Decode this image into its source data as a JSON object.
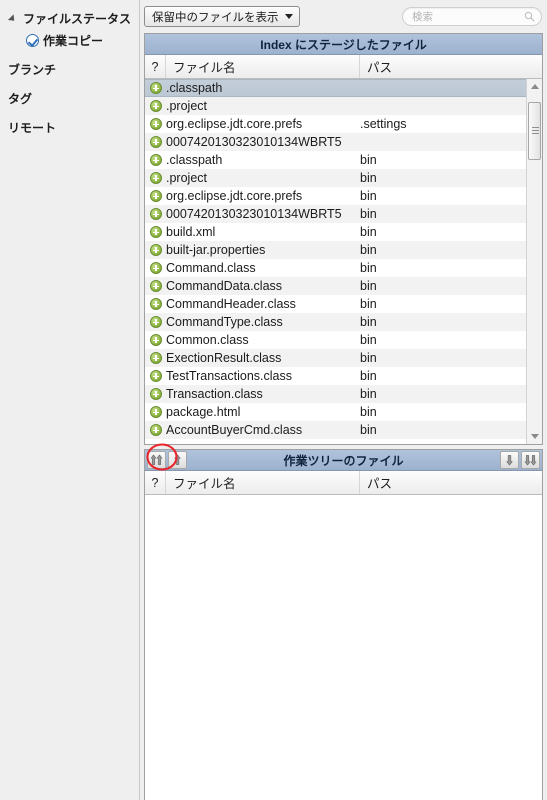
{
  "sidebar": {
    "items": [
      {
        "label": "ファイルステータス",
        "icon": "disclosure-triangle-icon",
        "level": 0,
        "selected": false
      },
      {
        "label": "作業コピー",
        "icon": "check-circle-icon",
        "level": 1,
        "selected": false
      },
      {
        "label": "ブランチ",
        "icon": "",
        "level": 0,
        "selected": false
      },
      {
        "label": "タグ",
        "icon": "",
        "level": 0,
        "selected": false
      },
      {
        "label": "リモート",
        "icon": "",
        "level": 0,
        "selected": false
      }
    ]
  },
  "toolbar": {
    "filter_label": "保留中のファイルを表示",
    "filter_caret_icon": "chevron-down-icon",
    "search_placeholder": "検索",
    "search_value": "",
    "search_icon": "search-icon"
  },
  "staged_panel": {
    "title": "Index にステージしたファイル",
    "columns": [
      "?",
      "ファイル名",
      "パス"
    ],
    "rows": [
      {
        "status_icon": "plus-circle-green-icon",
        "name": ".classpath",
        "path": "",
        "selected": true
      },
      {
        "status_icon": "plus-circle-green-icon",
        "name": ".project",
        "path": "",
        "selected": false
      },
      {
        "status_icon": "plus-circle-green-icon",
        "name": "org.eclipse.jdt.core.prefs",
        "path": ".settings",
        "selected": false
      },
      {
        "status_icon": "plus-circle-green-icon",
        "name": "0007420130323010134WBRT5",
        "path": "",
        "selected": false
      },
      {
        "status_icon": "plus-circle-green-icon",
        "name": ".classpath",
        "path": "bin",
        "selected": false
      },
      {
        "status_icon": "plus-circle-green-icon",
        "name": ".project",
        "path": "bin",
        "selected": false
      },
      {
        "status_icon": "plus-circle-green-icon",
        "name": "org.eclipse.jdt.core.prefs",
        "path": "bin",
        "selected": false
      },
      {
        "status_icon": "plus-circle-green-icon",
        "name": "0007420130323010134WBRT5",
        "path": "bin",
        "selected": false
      },
      {
        "status_icon": "plus-circle-green-icon",
        "name": "build.xml",
        "path": "bin",
        "selected": false
      },
      {
        "status_icon": "plus-circle-green-icon",
        "name": "built-jar.properties",
        "path": "bin",
        "selected": false
      },
      {
        "status_icon": "plus-circle-green-icon",
        "name": "Command.class",
        "path": "bin",
        "selected": false
      },
      {
        "status_icon": "plus-circle-green-icon",
        "name": "CommandData.class",
        "path": "bin",
        "selected": false
      },
      {
        "status_icon": "plus-circle-green-icon",
        "name": "CommandHeader.class",
        "path": "bin",
        "selected": false
      },
      {
        "status_icon": "plus-circle-green-icon",
        "name": "CommandType.class",
        "path": "bin",
        "selected": false
      },
      {
        "status_icon": "plus-circle-green-icon",
        "name": "Common.class",
        "path": "bin",
        "selected": false
      },
      {
        "status_icon": "plus-circle-green-icon",
        "name": "ExectionResult.class",
        "path": "bin",
        "selected": false
      },
      {
        "status_icon": "plus-circle-green-icon",
        "name": "TestTransactions.class",
        "path": "bin",
        "selected": false
      },
      {
        "status_icon": "plus-circle-green-icon",
        "name": "Transaction.class",
        "path": "bin",
        "selected": false
      },
      {
        "status_icon": "plus-circle-green-icon",
        "name": "package.html",
        "path": "bin",
        "selected": false
      },
      {
        "status_icon": "plus-circle-green-icon",
        "name": "AccountBuyerCmd.class",
        "path": "bin",
        "selected": false
      }
    ],
    "scrollbar": {
      "up_arrow_icon": "triangle-up-icon",
      "down_arrow_icon": "triangle-down-icon"
    }
  },
  "worktree_panel": {
    "title": "作業ツリーのファイル",
    "columns": [
      "?",
      "ファイル名",
      "パス"
    ],
    "rows": [],
    "buttons": {
      "stage_all_icon": "double-arrow-up-icon",
      "stage_selected_icon": "arrow-up-icon",
      "unstage_selected_icon": "arrow-down-icon",
      "unstage_all_icon": "double-arrow-down-icon"
    }
  },
  "annotation": {
    "shape": "ellipse",
    "color": "#e8262b",
    "target": "stage-all-button"
  }
}
